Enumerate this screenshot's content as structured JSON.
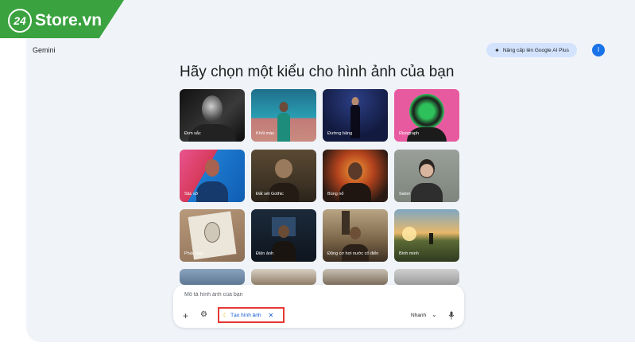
{
  "brand": {
    "badge": "24",
    "name": "Store.vn"
  },
  "app": {
    "title": "Gemini",
    "upgrade_label": "Nâng cấp lên Google AI Plus",
    "avatar_letter": "I",
    "heading": "Hãy chọn một kiểu cho hình ảnh của bạn"
  },
  "styles": [
    {
      "label": "Đơn sắc"
    },
    {
      "label": "Khối màu"
    },
    {
      "label": "Đường băng"
    },
    {
      "label": "Risograph"
    },
    {
      "label": "Sặc sỡ"
    },
    {
      "label": "Đất sét Gothic"
    },
    {
      "label": "Bùng nổ"
    },
    {
      "label": "Salon"
    },
    {
      "label": "Phác hoạ"
    },
    {
      "label": "Điện ảnh"
    },
    {
      "label": "Động cơ hơi nước cổ điển"
    },
    {
      "label": "Bình minh"
    }
  ],
  "prompt": {
    "placeholder": "Mô tả hình ảnh của bạn",
    "add_icon": "plus-icon",
    "tools_icon": "tune-icon",
    "chip_label": "Tạo hình ảnh",
    "chip_icon": "banana-icon",
    "speed_label": "Nhanh",
    "mic_icon": "mic-icon"
  },
  "colors": {
    "accent": "#0b57d0",
    "highlight_box": "#e53935",
    "brand_green": "#3aa23f",
    "surface": "#f0f4f9"
  }
}
